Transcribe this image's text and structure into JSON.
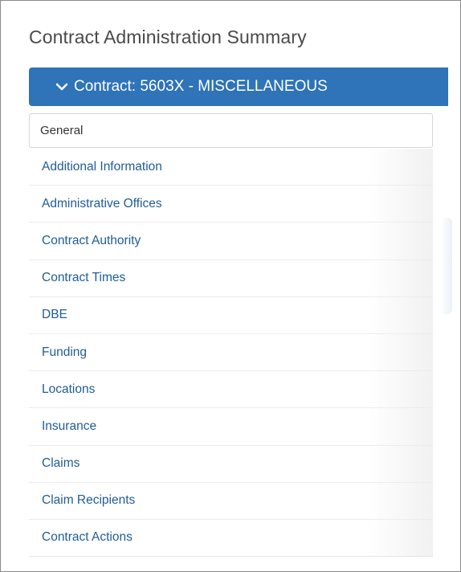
{
  "page": {
    "title": "Contract Administration Summary"
  },
  "contract_bar": {
    "label": "Contract: 5603X - MISCELLANEOUS",
    "icon": "chevron-down-icon",
    "color": "#2f73b8"
  },
  "general_tab": {
    "label": "General"
  },
  "sections": [
    {
      "label": "Additional Information"
    },
    {
      "label": "Administrative Offices"
    },
    {
      "label": "Contract Authority"
    },
    {
      "label": "Contract Times"
    },
    {
      "label": "DBE"
    },
    {
      "label": "Funding"
    },
    {
      "label": "Locations"
    },
    {
      "label": "Insurance"
    },
    {
      "label": "Claims"
    },
    {
      "label": "Claim Recipients"
    },
    {
      "label": "Contract Actions"
    }
  ],
  "colors": {
    "link": "#1f5c96",
    "title": "#4a4a4a"
  }
}
